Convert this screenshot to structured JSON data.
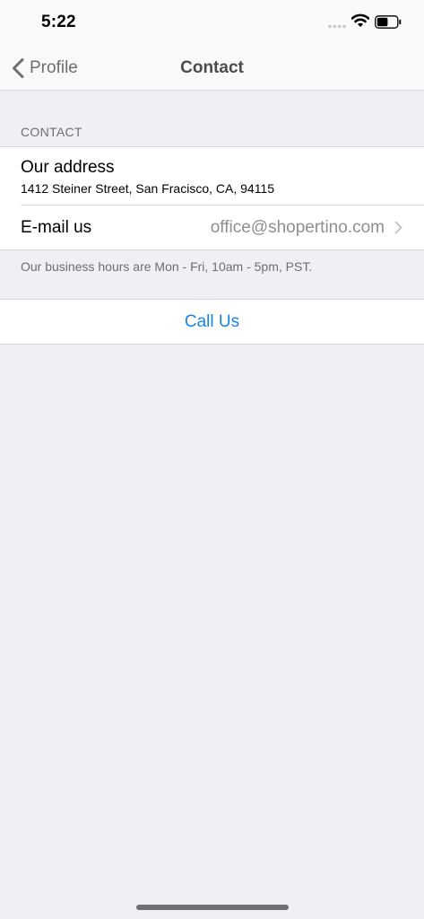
{
  "status_bar": {
    "time": "5:22",
    "icons": [
      "signal-icon",
      "wifi-icon",
      "battery-icon"
    ],
    "battery_level_fraction": 0.55
  },
  "nav": {
    "back_label": "Profile",
    "title": "Contact",
    "back_icon": "chevron-left-icon"
  },
  "contact_section": {
    "header": "CONTACT",
    "address_title": "Our address",
    "address_value": "1412 Steiner Street, San Fracisco, CA, 94115",
    "email_label": "E-mail us",
    "email_value": "office@shopertino.com",
    "email_icon": "chevron-right-icon",
    "footer": "Our business hours are Mon - Fri, 10am - 5pm, PST."
  },
  "call_button": {
    "label": "Call Us"
  },
  "colors": {
    "background": "#EFEFF4",
    "bar_background": "#F9F9F9",
    "cell_background": "#FFFFFF",
    "separator": "#D8D8DC",
    "secondary_text": "#6D6D72",
    "detail_text": "#8E8E93",
    "accent": "#1A84E4"
  }
}
